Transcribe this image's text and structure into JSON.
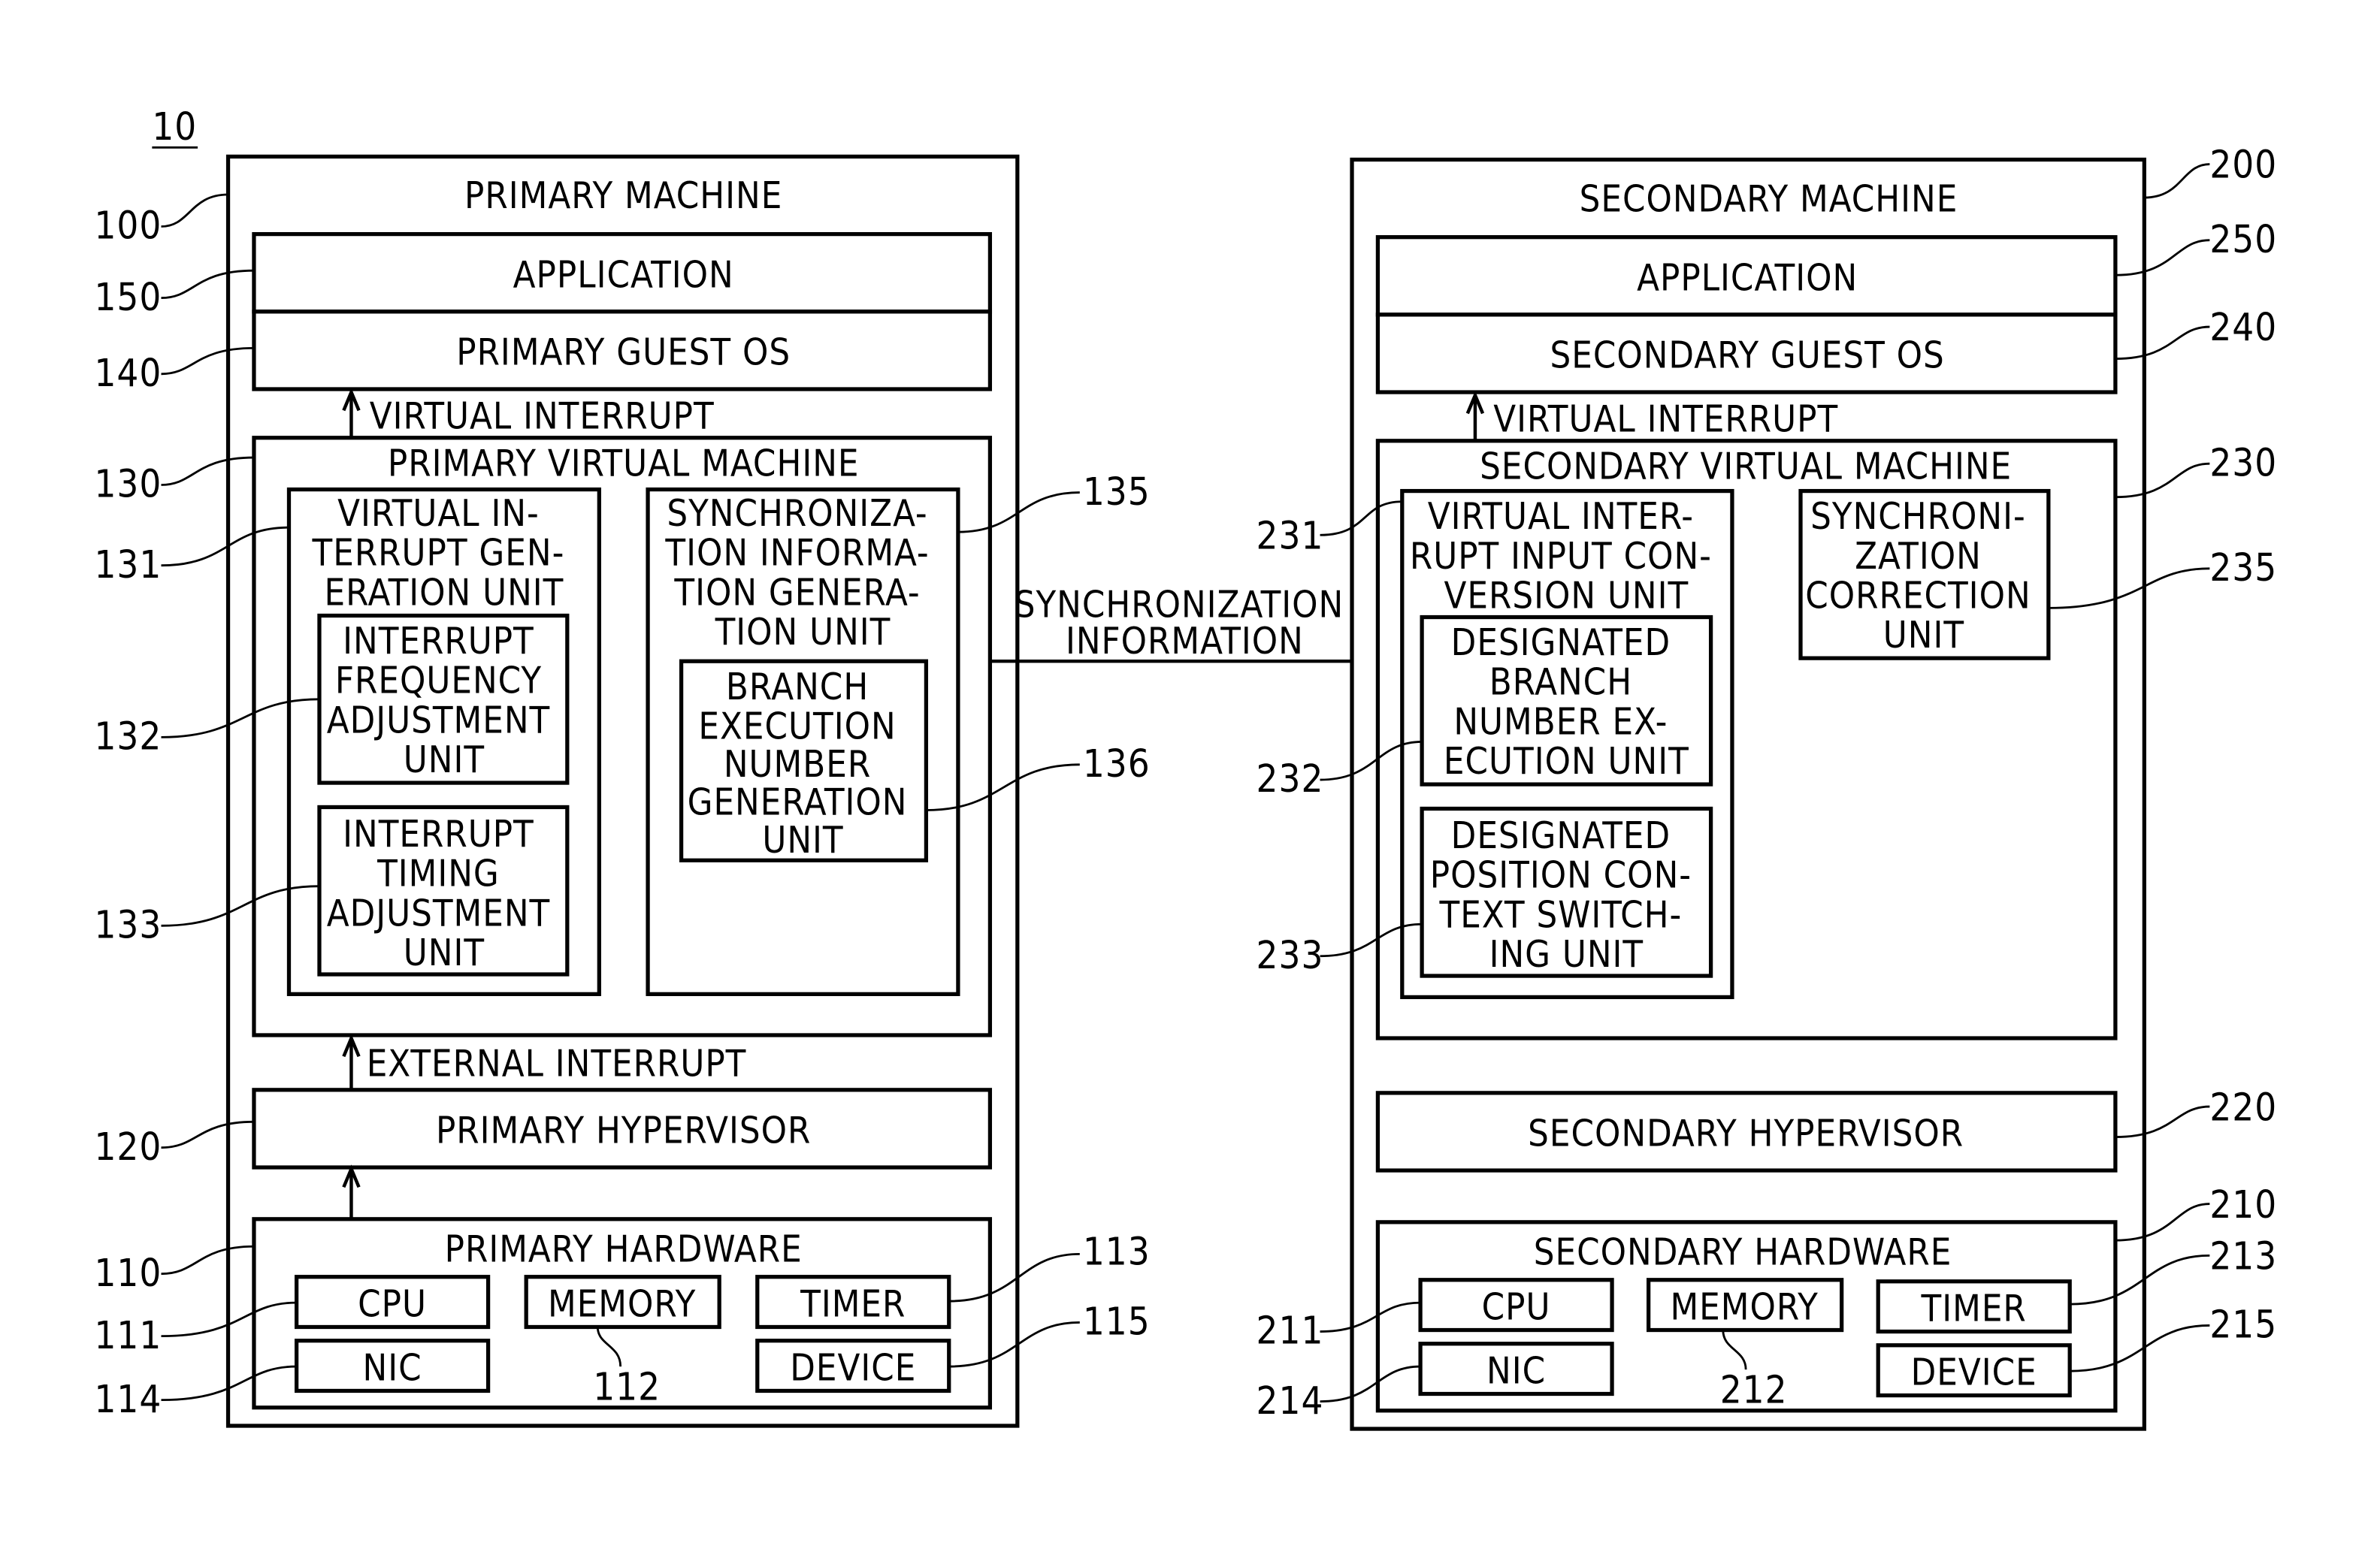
{
  "figure": {
    "figure_ref": "10",
    "colors": {
      "stroke": "#000000",
      "background": "#ffffff"
    }
  },
  "primary": {
    "ref": "100",
    "title": "PRIMARY MACHINE",
    "application": {
      "ref": "150",
      "label": "APPLICATION"
    },
    "guest_os": {
      "ref": "140",
      "label": "PRIMARY GUEST OS"
    },
    "virtual_interrupt_label": "VIRTUAL INTERRUPT",
    "vm": {
      "ref": "130",
      "title": "PRIMARY VIRTUAL MACHINE",
      "interrupt_gen_unit": {
        "ref": "131",
        "lines": [
          "VIRTUAL IN-",
          "TERRUPT GEN-",
          "ERATION UNIT"
        ]
      },
      "freq_adjust_unit": {
        "ref": "132",
        "lines": [
          "INTERRUPT",
          "FREQUENCY",
          "ADJUSTMENT",
          "UNIT"
        ]
      },
      "timing_adjust_unit": {
        "ref": "133",
        "lines": [
          "INTERRUPT",
          "TIMING",
          "ADJUSTMENT",
          "UNIT"
        ]
      },
      "sync_info_gen_unit": {
        "ref": "135",
        "lines": [
          "SYNCHRONIZA-",
          "TION INFORMA-",
          "TION GENERA-",
          "TION UNIT"
        ]
      },
      "branch_exec_gen_unit": {
        "ref": "136",
        "lines": [
          "BRANCH",
          "EXECUTION",
          "NUMBER",
          "GENERATION",
          "UNIT"
        ]
      }
    },
    "external_interrupt_label": "EXTERNAL INTERRUPT",
    "hypervisor": {
      "ref": "120",
      "label": "PRIMARY HYPERVISOR"
    },
    "hardware": {
      "ref": "110",
      "title": "PRIMARY HARDWARE",
      "cpu": {
        "ref": "111",
        "label": "CPU"
      },
      "memory": {
        "ref": "112",
        "label": "MEMORY"
      },
      "timer": {
        "ref": "113",
        "label": "TIMER"
      },
      "nic": {
        "ref": "114",
        "label": "NIC"
      },
      "device": {
        "ref": "115",
        "label": "DEVICE"
      }
    }
  },
  "sync_arrow": {
    "lines": [
      "SYNCHRONIZATION",
      "INFORMATION"
    ]
  },
  "secondary": {
    "ref": "200",
    "title": "SECONDARY MACHINE",
    "application": {
      "ref": "250",
      "label": "APPLICATION"
    },
    "guest_os": {
      "ref": "240",
      "label": "SECONDARY GUEST OS"
    },
    "virtual_interrupt_label": "VIRTUAL INTERRUPT",
    "vm": {
      "ref": "230",
      "title": "SECONDARY VIRTUAL MACHINE",
      "input_conversion_unit": {
        "ref": "231",
        "lines": [
          "VIRTUAL INTER-",
          "RUPT INPUT CON-",
          "VERSION UNIT"
        ]
      },
      "branch_exec_unit": {
        "ref": "232",
        "lines": [
          "DESIGNATED",
          "BRANCH",
          "NUMBER EX-",
          "ECUTION UNIT"
        ]
      },
      "context_switch_unit": {
        "ref": "233",
        "lines": [
          "DESIGNATED",
          "POSITION CON-",
          "TEXT SWITCH-",
          "ING UNIT"
        ]
      },
      "sync_correction_unit": {
        "ref": "235",
        "lines": [
          "SYNCHRONI-",
          "ZATION",
          "CORRECTION",
          "UNIT"
        ]
      }
    },
    "hypervisor": {
      "ref": "220",
      "label": "SECONDARY HYPERVISOR"
    },
    "hardware": {
      "ref": "210",
      "title": "SECONDARY HARDWARE",
      "cpu": {
        "ref": "211",
        "label": "CPU"
      },
      "memory": {
        "ref": "212",
        "label": "MEMORY"
      },
      "timer": {
        "ref": "213",
        "label": "TIMER"
      },
      "nic": {
        "ref": "214",
        "label": "NIC"
      },
      "device": {
        "ref": "215",
        "label": "DEVICE"
      }
    }
  }
}
